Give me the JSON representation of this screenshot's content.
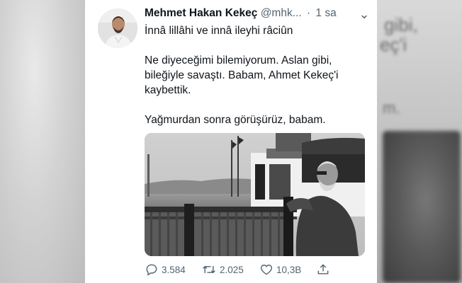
{
  "tweet": {
    "display_name": "Mehmet Hakan Kekeç",
    "handle": "@mhk...",
    "separator": "·",
    "time": "1 sa",
    "more_glyph": "⌄",
    "text_lines": [
      "İnnâ lillâhi ve innâ ileyhi râciûn",
      "",
      "Ne diyeceğimi bilemiyorum. Aslan gibi,",
      "bileğiyle savaştı. Babam, Ahmet Kekeç'i",
      "kaybettik.",
      "",
      "Yağmurdan sonra görüşürüz, babam."
    ],
    "media_description": "black-and-white photo of an elderly man leaning on a railing by a waterfront"
  },
  "actions": {
    "replies": "3.584",
    "retweets": "2.025",
    "likes": "10,3B"
  },
  "colors": {
    "text": "#0f1419",
    "secondary": "#536471",
    "card_bg": "#ffffff"
  },
  "icons": {
    "reply": "reply-icon",
    "retweet": "retweet-icon",
    "like": "heart-icon",
    "share": "share-icon",
    "more": "chevron-down-icon"
  }
}
